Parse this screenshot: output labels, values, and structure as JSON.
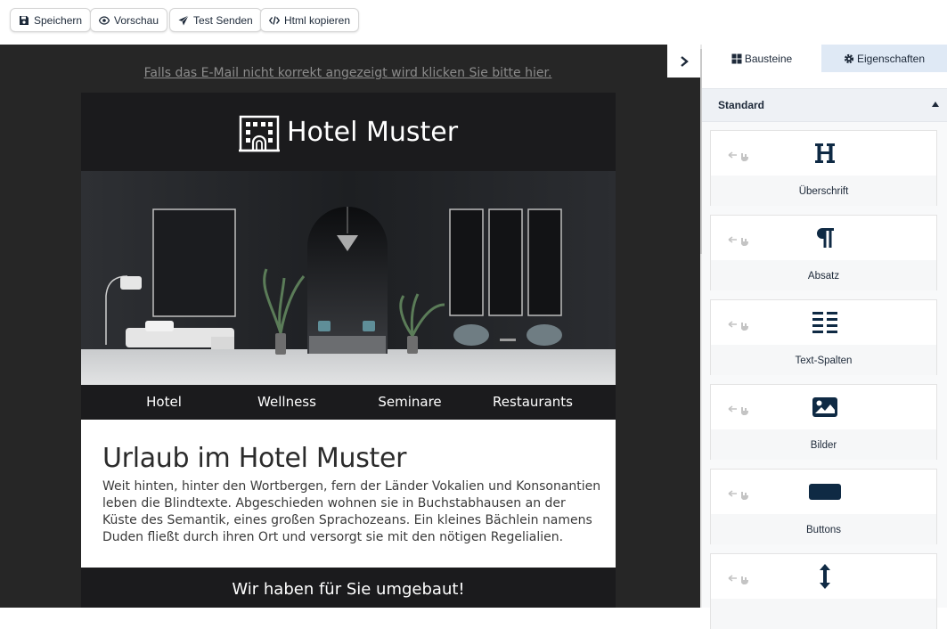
{
  "toolbar": {
    "save_label": "Speichern",
    "preview_label": "Vorschau",
    "test_send_label": "Test Senden",
    "copy_html_label": "Html kopieren"
  },
  "email": {
    "fallback_link": "Falls das E-Mail nicht korrekt angezeigt wird klicken Sie bitte hier.",
    "brand": "Hotel Muster",
    "nav": [
      "Hotel",
      "Wellness",
      "Seminare",
      "Restaurants"
    ],
    "headline": "Urlaub im Hotel Muster",
    "body": "Weit hinten, hinter den Wortbergen, fern der Länder Vokalien und Konsonantien leben die Blindtexte. Abgeschieden wohnen sie in Buchstabhausen an der Küste des Semantik, eines großen Sprachozeans. Ein kleines Bächlein namens Duden fließt durch ihren Ort und versorgt sie mit den nötigen Regelialien.",
    "subheadline": "Wir haben für Sie umgebaut!"
  },
  "panel": {
    "tabs": [
      {
        "label": "Bausteine",
        "icon": "grid-icon",
        "active": true
      },
      {
        "label": "Eigenschaften",
        "icon": "gear-icon",
        "active": false
      }
    ],
    "section_title": "Standard",
    "blocks": [
      {
        "label": "Überschrift",
        "icon": "heading-icon"
      },
      {
        "label": "Absatz",
        "icon": "paragraph-icon"
      },
      {
        "label": "Text-Spalten",
        "icon": "columns-icon"
      },
      {
        "label": "Bilder",
        "icon": "image-icon"
      },
      {
        "label": "Buttons",
        "icon": "button-icon"
      },
      {
        "label": "",
        "icon": "spacer-icon"
      }
    ]
  },
  "colors": {
    "canvas_bg": "#262626",
    "email_dark": "#1b1b1d",
    "icon_navy": "#0f2a44",
    "active_tab": "#ffffff",
    "inactive_tab": "#dfe9f5"
  }
}
